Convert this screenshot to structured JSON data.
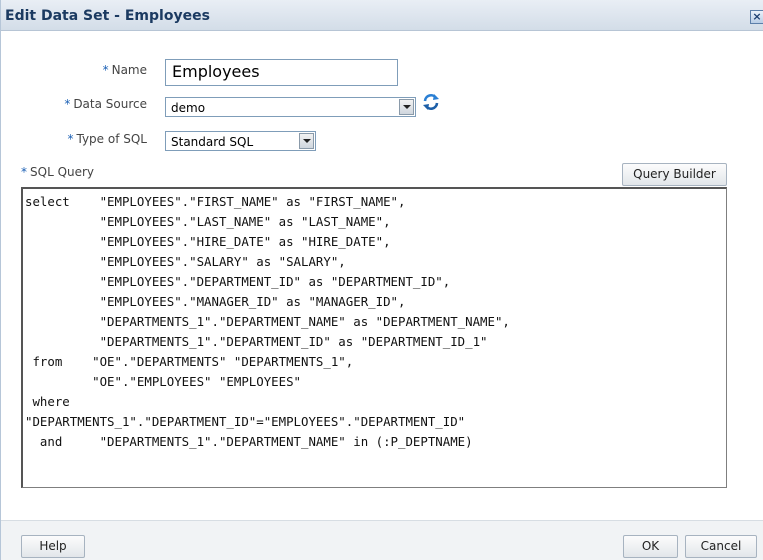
{
  "dialog": {
    "title": "Edit Data Set - Employees",
    "close_label": "×"
  },
  "form": {
    "required_marker": "*",
    "name_label": "Name",
    "name_value": "Employees",
    "data_source_label": "Data Source",
    "data_source_value": "demo",
    "type_of_sql_label": "Type of SQL",
    "type_of_sql_value": "Standard SQL",
    "sql_query_label": "SQL Query",
    "query_builder_label": "Query Builder",
    "sql_query_text": "select    \"EMPLOYEES\".\"FIRST_NAME\" as \"FIRST_NAME\",\n          \"EMPLOYEES\".\"LAST_NAME\" as \"LAST_NAME\",\n          \"EMPLOYEES\".\"HIRE_DATE\" as \"HIRE_DATE\",\n          \"EMPLOYEES\".\"SALARY\" as \"SALARY\",\n          \"EMPLOYEES\".\"DEPARTMENT_ID\" as \"DEPARTMENT_ID\",\n          \"EMPLOYEES\".\"MANAGER_ID\" as \"MANAGER_ID\",\n          \"DEPARTMENTS_1\".\"DEPARTMENT_NAME\" as \"DEPARTMENT_NAME\",\n          \"DEPARTMENTS_1\".\"DEPARTMENT_ID\" as \"DEPARTMENT_ID_1\"\n from    \"OE\".\"DEPARTMENTS\" \"DEPARTMENTS_1\",\n         \"OE\".\"EMPLOYEES\" \"EMPLOYEES\"\n where\n\"DEPARTMENTS_1\".\"DEPARTMENT_ID\"=\"EMPLOYEES\".\"DEPARTMENT_ID\"\n  and     \"DEPARTMENTS_1\".\"DEPARTMENT_NAME\" in (:P_DEPTNAME)"
  },
  "footer": {
    "help_label": "Help",
    "ok_label": "OK",
    "cancel_label": "Cancel"
  },
  "icons": {
    "close": "close-icon",
    "refresh": "refresh-icon",
    "dropdown": "chevron-down-icon"
  },
  "colors": {
    "title_text": "#1b3a61",
    "required_marker": "#1a5fb4",
    "titlebar_bg": "#d3dde8"
  }
}
